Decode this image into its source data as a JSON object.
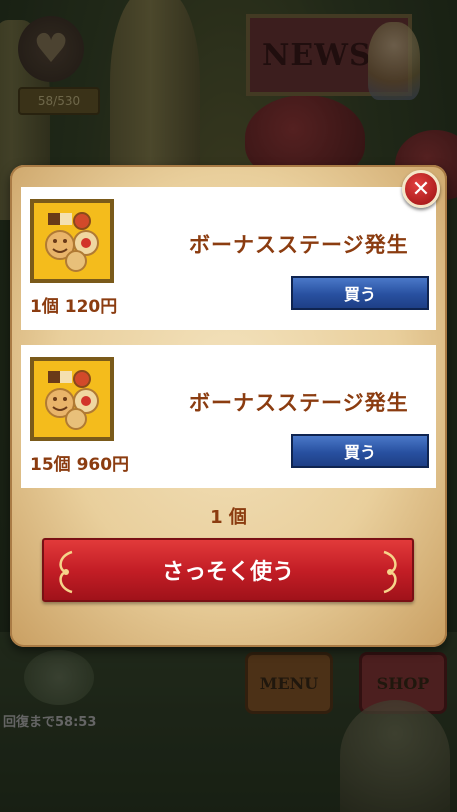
{
  "background": {
    "stamina_text": "58/530",
    "news_label": "NEWS",
    "menu_label": "MENU",
    "shop_label": "SHOP",
    "recover_text": "回復まで58:53"
  },
  "dialog": {
    "items": [
      {
        "title": "ボーナスステージ発生",
        "qty_price": "1個 120円",
        "buy_label": "買う"
      },
      {
        "title": "ボーナスステージ発生",
        "qty_price": "15個 960円",
        "buy_label": "買う"
      }
    ],
    "owned_count": "1 個",
    "use_label": "さっそく使う",
    "close_symbol": "✕"
  },
  "colors": {
    "accent_text": "#8b3c10",
    "buy_button": "#2850a0",
    "use_button": "#c41e26",
    "close_button": "#c01818"
  }
}
